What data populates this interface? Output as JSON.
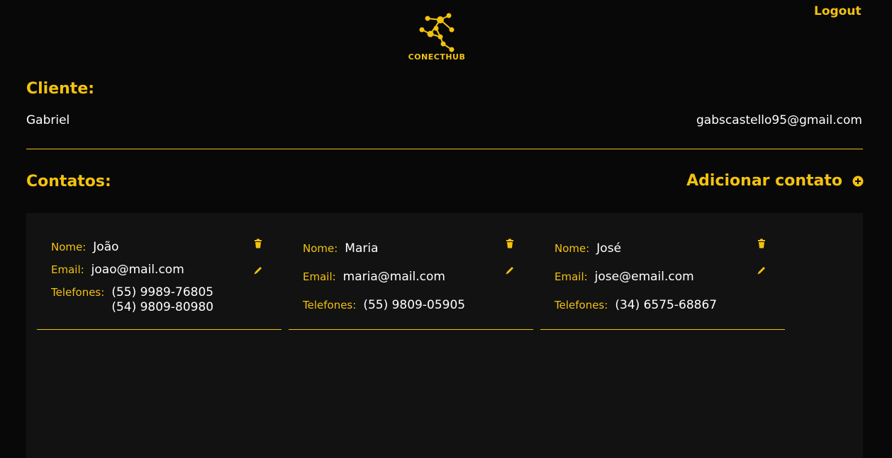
{
  "header": {
    "logout_label": "Logout",
    "logo_text": "CONECTHUB",
    "logo_icon": "network-nodes-icon"
  },
  "client": {
    "title": "Cliente:",
    "name": "Gabriel",
    "email": "gabscastello95@gmail.com"
  },
  "contacts": {
    "title": "Contatos:",
    "add_label": "Adicionar contato",
    "add_icon": "plus-circle-icon",
    "labels": {
      "name": "Nome:",
      "email": "Email:",
      "phones": "Telefones:"
    },
    "items": [
      {
        "name": "João",
        "email": "joao@mail.com",
        "phones": [
          "(55) 9989-76805",
          "(54) 9809-80980"
        ]
      },
      {
        "name": "Maria",
        "email": "maria@mail.com",
        "phones": [
          "(55) 9809-05905"
        ]
      },
      {
        "name": "José",
        "email": "jose@email.com",
        "phones": [
          "(34) 6575-68867"
        ]
      }
    ]
  },
  "colors": {
    "accent": "#f2c20f",
    "background": "#080808",
    "panel": "#121212",
    "text": "#ffffff"
  }
}
